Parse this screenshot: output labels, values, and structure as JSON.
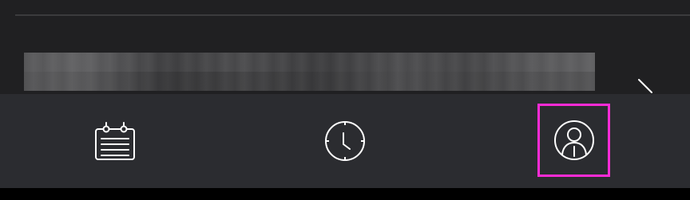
{
  "tab_bar": {
    "tabs": [
      {
        "icon": "calendar-icon"
      },
      {
        "icon": "clock-icon"
      },
      {
        "icon": "user-profile-icon",
        "selected_highlight_color": "#ff2bd6"
      }
    ]
  },
  "content": {
    "list_item_icon": "chevron-right-icon"
  },
  "colors": {
    "content_background": "#202022",
    "tab_bar_background": "#2b2c30",
    "divider": "#3b3b3d",
    "icon_stroke": "#ffffff",
    "highlight": "#ff2bd6"
  }
}
